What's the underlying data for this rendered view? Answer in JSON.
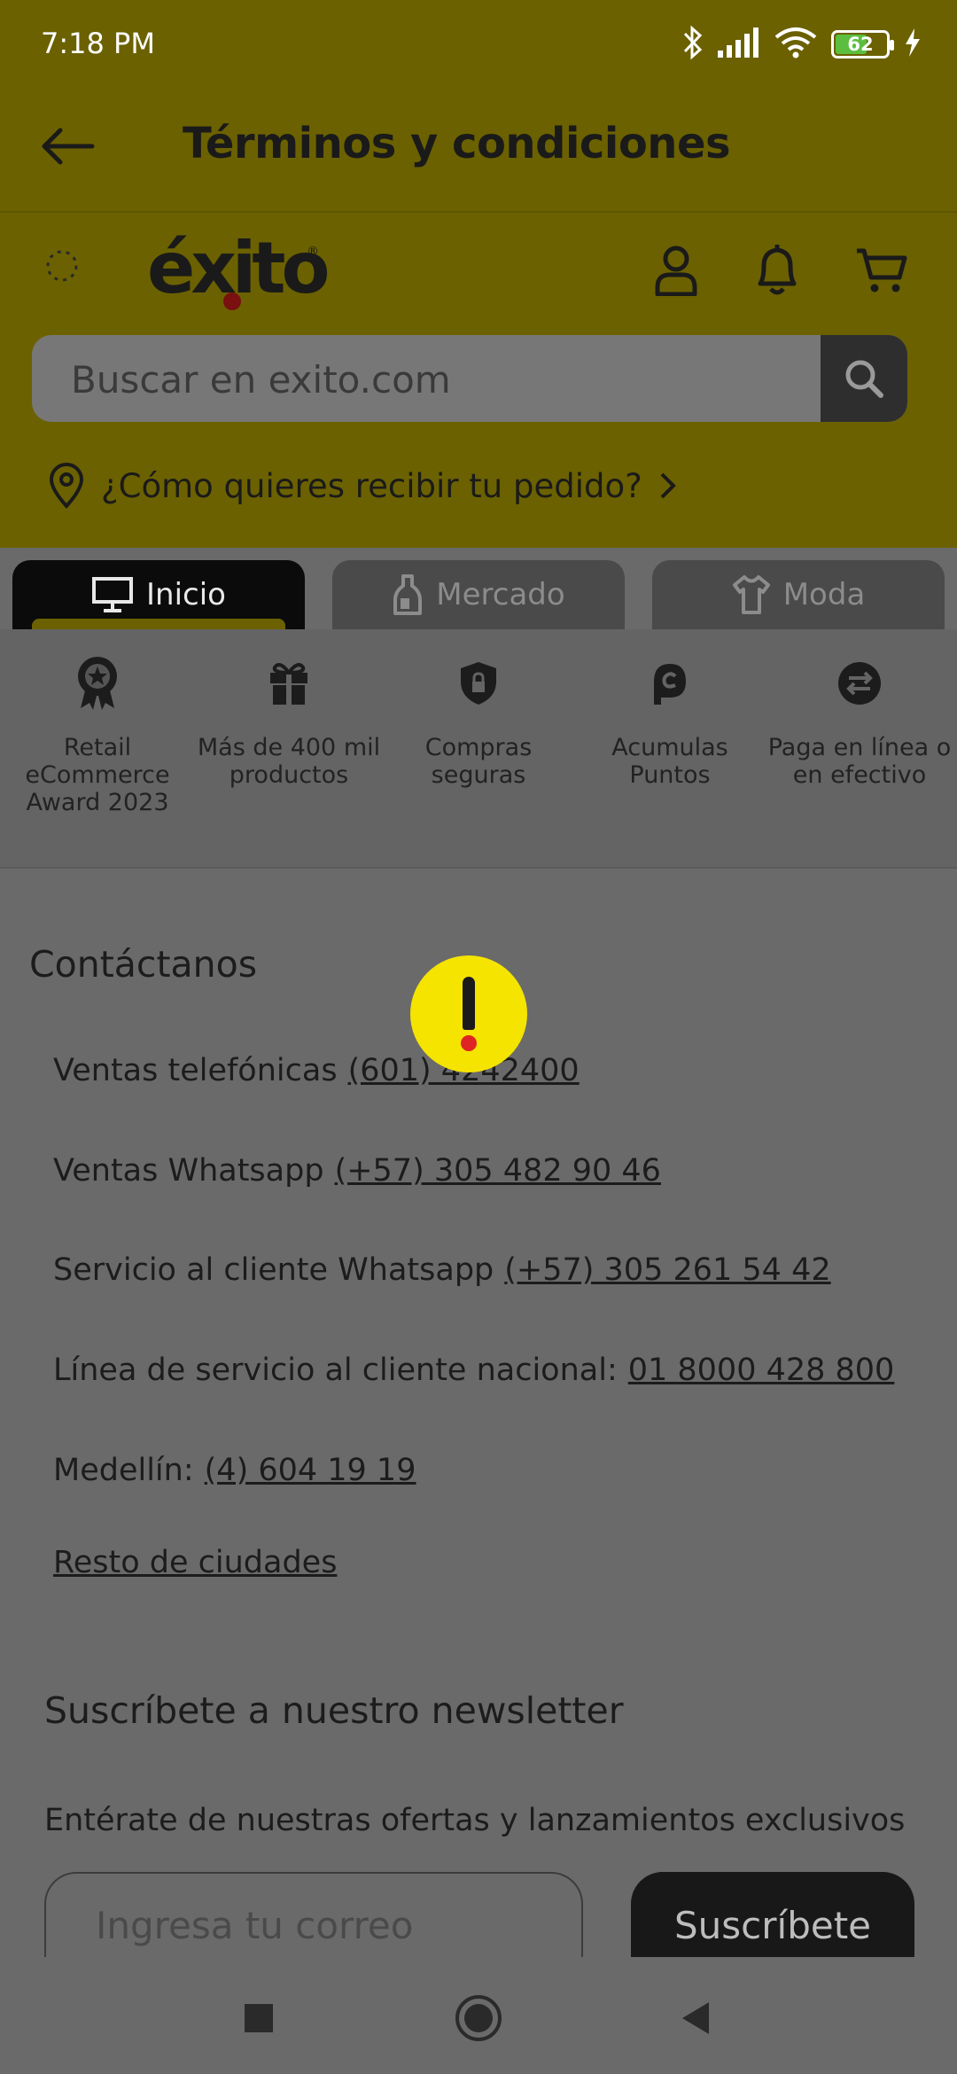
{
  "status_bar": {
    "time": "7:18 PM",
    "battery": "62",
    "battery_level": 0.62
  },
  "title_bar": {
    "title": "Términos y condiciones"
  },
  "header": {
    "logo_text": "éxito",
    "logo_reg": "®",
    "search_placeholder": "Buscar en exito.com",
    "delivery_prompt": "¿Cómo quieres recibir tu pedido?"
  },
  "tabs": [
    {
      "label": "Inicio",
      "icon": "monitor-icon",
      "active": true
    },
    {
      "label": "Mercado",
      "icon": "bottle-icon",
      "active": false
    },
    {
      "label": "Moda",
      "icon": "shirt-icon",
      "active": false
    }
  ],
  "benefits": [
    {
      "label": "Retail eCommerce Award 2023",
      "icon": "award-icon"
    },
    {
      "label": "Más de 400 mil productos",
      "icon": "gift-icon"
    },
    {
      "label": "Compras seguras",
      "icon": "shield-lock-icon"
    },
    {
      "label": "Acumulas Puntos",
      "icon": "points-icon"
    },
    {
      "label": "Paga en línea o en efectivo",
      "icon": "exchange-icon"
    }
  ],
  "contact": {
    "heading": "Contáctanos",
    "rows": [
      {
        "label": "Ventas telefónicas",
        "value": "(601) 4242400"
      },
      {
        "label": "Ventas Whatsapp",
        "value": "(+57) 305 482 90 46"
      },
      {
        "label": "Servicio al cliente Whatsapp",
        "value": "(+57) 305 261 54 42"
      },
      {
        "label": "Línea de servicio al cliente nacional:",
        "value": "01 8000 428 800"
      },
      {
        "label": "Medellín:",
        "value": "(4) 604 19 19"
      }
    ],
    "other_cities": "Resto de ciudades"
  },
  "newsletter": {
    "heading": "Suscríbete a nuestro newsletter",
    "subtitle": "Entérate de nuestras ofertas y lanzamientos exclusivos",
    "email_placeholder": "Ingresa tu correo",
    "button_label": "Suscríbete"
  },
  "colors": {
    "header_overlay": "#6b6100",
    "alert_yellow": "#f5e400",
    "alert_red": "#e02424",
    "battery_green": "#5cbe3f"
  }
}
